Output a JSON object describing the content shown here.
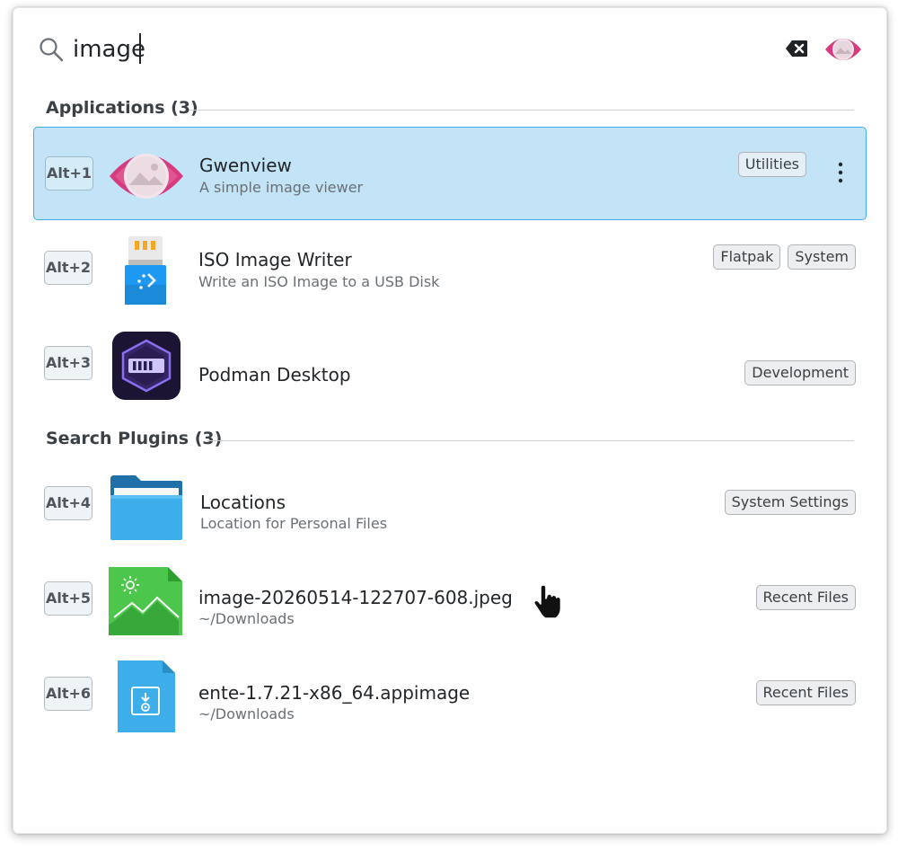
{
  "search": {
    "query": "image",
    "placeholder": ""
  },
  "sections": [
    {
      "title": "Applications (3)",
      "items": [
        {
          "shortcut": "Alt+1",
          "title": "Gwenview",
          "subtitle": "A simple image viewer",
          "tags": [
            "Utilities"
          ],
          "icon": "gwenview-icon",
          "selected": true
        },
        {
          "shortcut": "Alt+2",
          "title": "ISO Image Writer",
          "subtitle": "Write an ISO Image to a USB Disk",
          "tags": [
            "Flatpak",
            "System"
          ],
          "icon": "usb-drive-icon",
          "selected": false
        },
        {
          "shortcut": "Alt+3",
          "title": "Podman Desktop",
          "subtitle": "",
          "tags": [
            "Development"
          ],
          "icon": "podman-desktop-icon",
          "selected": false
        }
      ]
    },
    {
      "title": "Search Plugins (3)",
      "items": [
        {
          "shortcut": "Alt+4",
          "title": "Locations",
          "subtitle": "Location for Personal Files",
          "tags": [
            "System Settings"
          ],
          "icon": "folder-icon",
          "selected": false
        },
        {
          "shortcut": "Alt+5",
          "title": "image-20260514-122707-608.jpeg",
          "subtitle": "~/Downloads",
          "tags": [
            "Recent Files"
          ],
          "icon": "image-file-icon",
          "selected": false
        },
        {
          "shortcut": "Alt+6",
          "title": "ente-1.7.21-x86_64.appimage",
          "subtitle": "~/Downloads",
          "tags": [
            "Recent Files"
          ],
          "icon": "appimage-file-icon",
          "selected": false
        }
      ]
    }
  ],
  "colors": {
    "accent": "#3daee9",
    "selected_bg": "#c3e3f6",
    "gwenview": "#d63b7f"
  }
}
